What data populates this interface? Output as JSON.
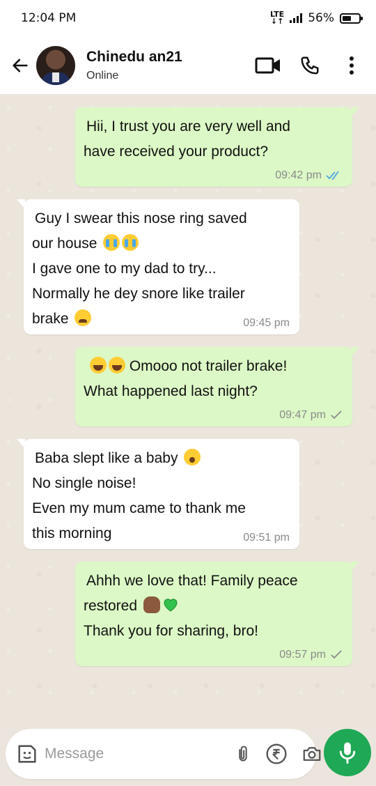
{
  "status_bar": {
    "time": "12:04 PM",
    "network": "LTE",
    "battery": "56%",
    "battery_level": 0.56
  },
  "header": {
    "contact_name": "Chinedu an21",
    "contact_status": "Online",
    "icons": [
      "back-arrow-icon",
      "video-call-icon",
      "phone-icon",
      "more-vert-icon"
    ]
  },
  "messages": [
    {
      "direction": "outgoing",
      "lines": [
        "Hii, I trust you are very well and",
        "have received your product?"
      ],
      "time": "09:42 pm",
      "status": "read"
    },
    {
      "direction": "incoming",
      "lines": [
        "Guy I swear this nose ring saved",
        "our house",
        "I gave one to my dad to try...",
        "Normally he dey snore like trailer",
        "brake"
      ],
      "time": "09:45 pm"
    },
    {
      "direction": "outgoing",
      "lines": [
        "Omooo not trailer brake!",
        "What happened last night?"
      ],
      "time": "09:47 pm",
      "status": "sent"
    },
    {
      "direction": "incoming",
      "lines": [
        "Baba slept like a baby",
        "No single noise!",
        "Even my mum came to thank me",
        "this morning"
      ],
      "time": "09:51 pm"
    },
    {
      "direction": "outgoing",
      "lines": [
        "Ahhh we love that! Family peace",
        "restored",
        "Thank you for sharing, bro!"
      ],
      "time": "09:57 pm",
      "status": "sent"
    }
  ],
  "composer": {
    "placeholder": "Message",
    "icons": [
      "sticker-icon",
      "attach-icon",
      "rupee-payment-icon",
      "camera-icon",
      "mic-icon"
    ]
  },
  "colors": {
    "outgoing_bubble": "#dcf8c6",
    "incoming_bubble": "#ffffff",
    "read_ticks": "#4fa6e0",
    "accent_green": "#1fa855"
  }
}
